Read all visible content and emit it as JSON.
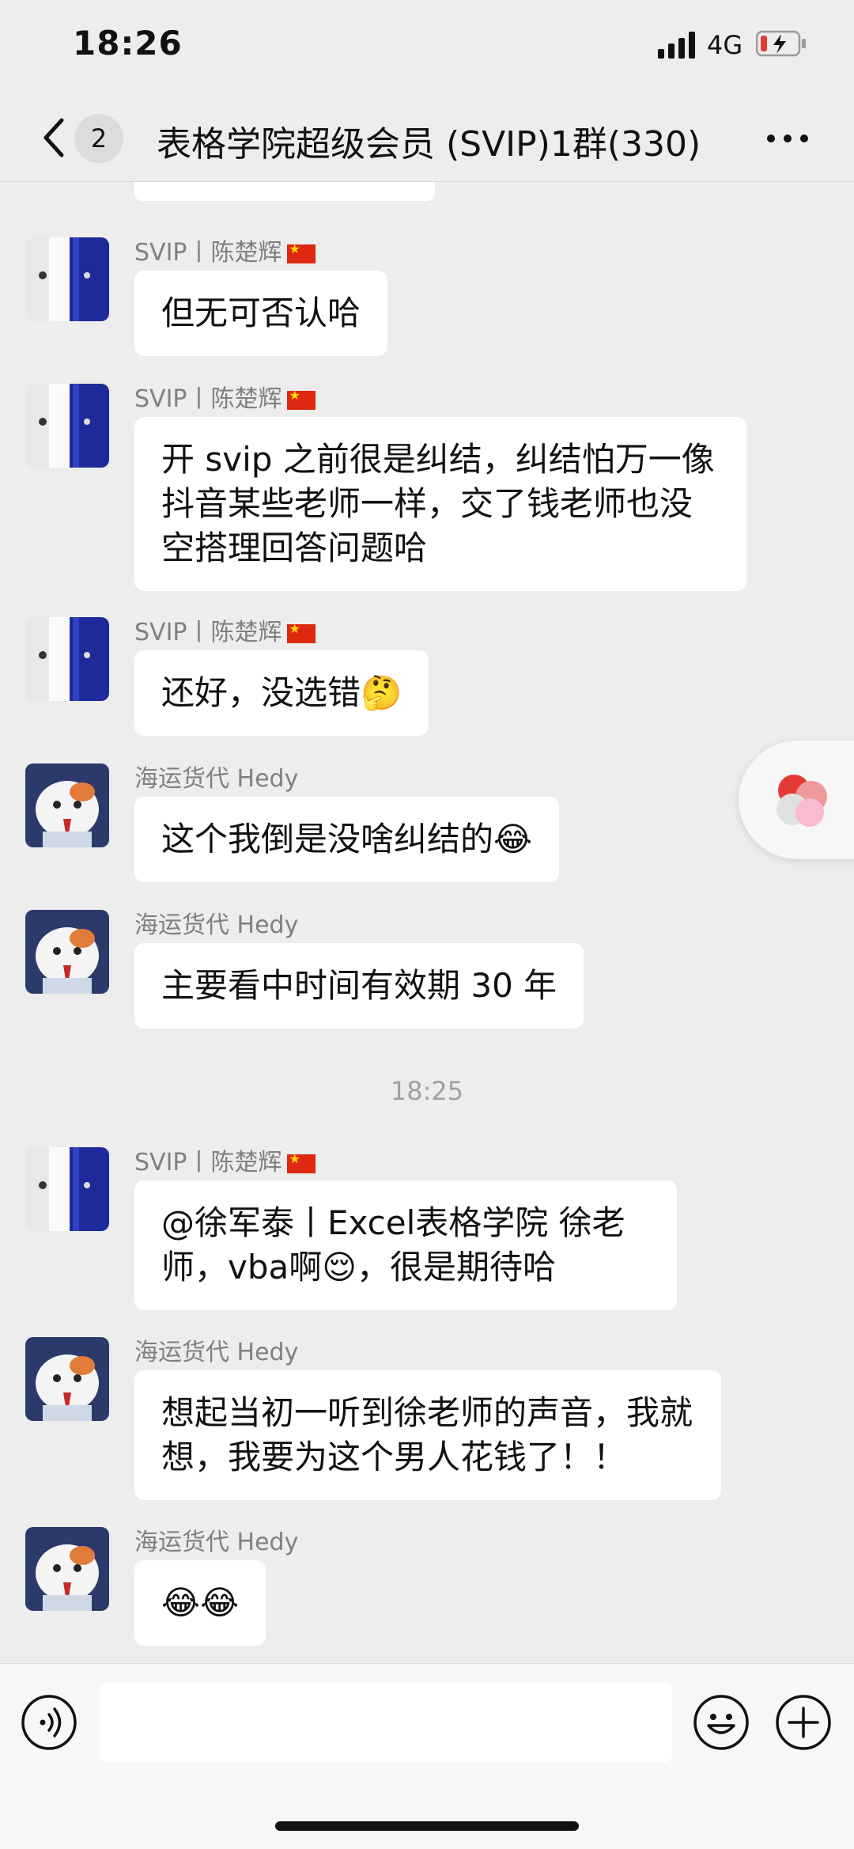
{
  "status": {
    "time": "18:26",
    "network": "4G"
  },
  "header": {
    "unread_count": "2",
    "title": "表格学院超级会员 (SVIP)1群(330)"
  },
  "messages": [
    {
      "sender": "SVIP丨陈楚辉",
      "text": "但无可否认哈",
      "avatar": "user-a"
    },
    {
      "sender": "SVIP丨陈楚辉",
      "text": "开 svip 之前很是纠结，纠结怕万一像抖音某些老师一样，交了钱老师也没空搭理回答问题哈",
      "avatar": "user-a"
    },
    {
      "sender": "SVIP丨陈楚辉",
      "text": "还好，没选错🤔",
      "avatar": "user-a"
    },
    {
      "sender": "海运货代 Hedy",
      "text": "这个我倒是没啥纠结的😂",
      "avatar": "user-b"
    },
    {
      "sender": "海运货代 Hedy",
      "text": "主要看中时间有效期 30 年",
      "avatar": "user-b"
    },
    {
      "sender": "SVIP丨陈楚辉",
      "text": "@徐军泰丨Excel表格学院 徐老师，vba啊😌，很是期待哈",
      "avatar": "user-a"
    },
    {
      "sender": "海运货代 Hedy",
      "text": "想起当初一听到徐老师的声音，我就想，我要为这个男人花钱了！！",
      "avatar": "user-b"
    },
    {
      "sender": "海运货代 Hedy",
      "text": "😂😂",
      "avatar": "user-b"
    }
  ],
  "time_separator": "18:25",
  "colors": {
    "background": "#ededed",
    "bubble": "#ffffff",
    "sender": "#808080"
  }
}
